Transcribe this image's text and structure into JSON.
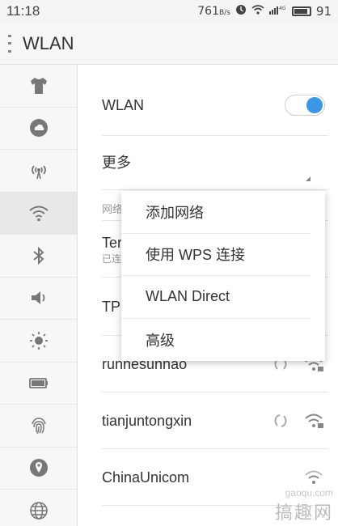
{
  "status_bar": {
    "time": "11:18",
    "speed": "761",
    "speed_unit": "B/s",
    "network": "4G",
    "battery": "91"
  },
  "title_bar": {
    "title": "WLAN"
  },
  "sidebar": {
    "items": [
      {
        "icon": "shirt-icon"
      },
      {
        "icon": "cloud-icon"
      },
      {
        "icon": "hotspot-icon"
      },
      {
        "icon": "wifi-icon"
      },
      {
        "icon": "bluetooth-icon"
      },
      {
        "icon": "volume-icon"
      },
      {
        "icon": "brightness-icon"
      },
      {
        "icon": "battery-icon"
      },
      {
        "icon": "fingerprint-icon"
      },
      {
        "icon": "location-icon"
      },
      {
        "icon": "globe-icon"
      }
    ]
  },
  "main": {
    "wlan_label": "WLAN",
    "more_label": "更多",
    "network_section_label": "网络",
    "networks": [
      {
        "name": "Ter",
        "status": "已连"
      },
      {
        "name": "TP",
        "status": ""
      },
      {
        "name": "runnesunnao",
        "status": ""
      },
      {
        "name": "tianjuntongxin",
        "status": ""
      },
      {
        "name": "ChinaUnicom",
        "status": ""
      }
    ]
  },
  "popup_menu": {
    "items": [
      "添加网络",
      "使用 WPS 连接",
      "WLAN Direct",
      "高级"
    ]
  },
  "watermark": {
    "top": "gaoqu.com",
    "bottom": "搞趣网"
  },
  "colors": {
    "accent": "#3b96e6",
    "background": "#ffffff",
    "sidebar": "#f7f7f7"
  }
}
